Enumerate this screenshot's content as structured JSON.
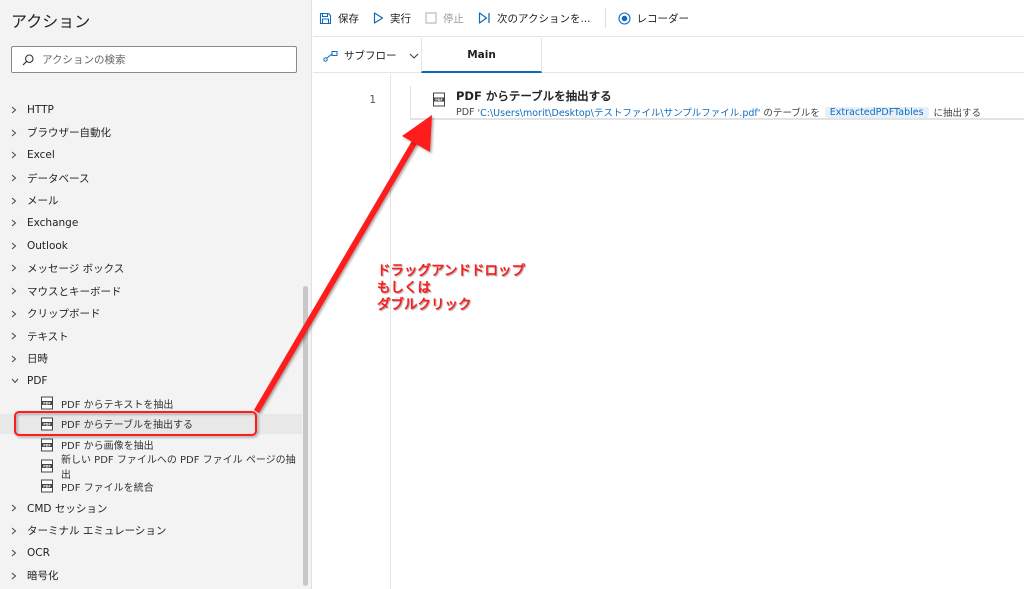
{
  "actions_panel": {
    "title": "アクション",
    "search_placeholder": "アクションの検索",
    "categories": [
      {
        "label": "HTTP"
      },
      {
        "label": "ブラウザー自動化"
      },
      {
        "label": "Excel"
      },
      {
        "label": "データベース"
      },
      {
        "label": "メール"
      },
      {
        "label": "Exchange"
      },
      {
        "label": "Outlook"
      },
      {
        "label": "メッセージ ボックス"
      },
      {
        "label": "マウスとキーボード"
      },
      {
        "label": "クリップボード"
      },
      {
        "label": "テキスト"
      },
      {
        "label": "日時"
      },
      {
        "label": "PDF",
        "expanded": true
      }
    ],
    "pdf_actions": [
      {
        "label": "PDF からテキストを抽出"
      },
      {
        "label": "PDF からテーブルを抽出する"
      },
      {
        "label": "PDF から画像を抽出"
      },
      {
        "label": "新しい PDF ファイルへの PDF ファイル ページの抽出"
      },
      {
        "label": "PDF ファイルを統合"
      }
    ],
    "categories_after": [
      {
        "label": "CMD セッション"
      },
      {
        "label": "ターミナル エミュレーション"
      },
      {
        "label": "OCR"
      },
      {
        "label": "暗号化"
      }
    ]
  },
  "toolbar": {
    "save": "保存",
    "run": "実行",
    "stop": "停止",
    "next_action": "次のアクションを...",
    "recorder": "レコーダー"
  },
  "tabs": {
    "subflow": "サブフロー",
    "main": "Main"
  },
  "editor": {
    "line_number": "1",
    "step_title": "PDF からテーブルを抽出する",
    "step_prefix": "PDF",
    "step_path": "'C:\\Users\\morit\\Desktop\\テストファイル\\サンプルファイル.pdf'",
    "step_middle": "のテーブルを",
    "step_variable": "ExtractedPDFTables",
    "step_suffix": "に抽出する"
  },
  "annotation": {
    "line1": "ドラッグアンドドロップ",
    "line2": "もしくは",
    "line3": "ダブルクリック",
    "color": "#ff1a1a"
  },
  "colors": {
    "accent": "#0f6cbd",
    "panel_bg": "#f3f3f3"
  }
}
